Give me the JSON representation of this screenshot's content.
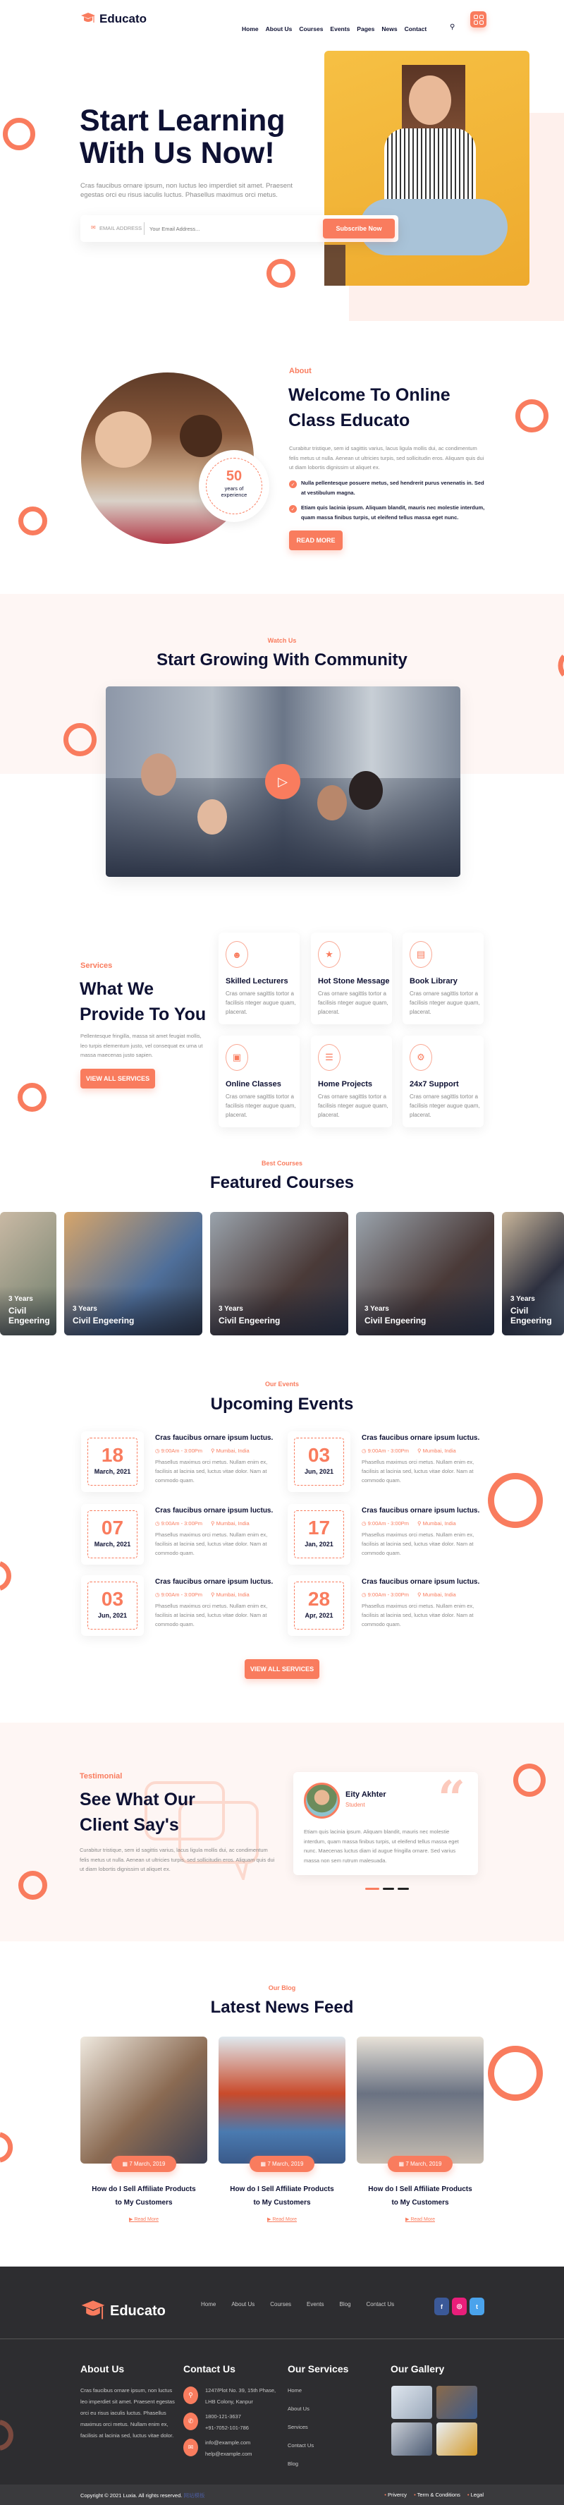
{
  "brand": {
    "name": "Educato",
    "accent": "#f97c5e",
    "dark": "#0e1133",
    "footer_bg": "#2d2d30"
  },
  "header": {
    "nav": [
      "Home",
      "About Us",
      "Courses",
      "Events",
      "Pages",
      "News",
      "Contact"
    ],
    "search_icon": "search-icon",
    "menu_icon": "grid-menu-icon"
  },
  "hero": {
    "title_line1": "Start Learning",
    "title_line2": "With Us Now!",
    "text": "Cras faucibus ornare ipsum, non luctus leo imperdiet sit amet. Praesent egestas orci eu risus iaculis luctus. Phasellus maximus orci metus.",
    "email_label": "EMAIL ADDRESS",
    "email_placeholder": "Your Email Address...",
    "subscribe": "Subscribe Now"
  },
  "about": {
    "sub": "About",
    "title_line1": "Welcome To Online",
    "title_line2": "Class Educato",
    "text": "Curabitur tristique, sem id sagittis varius, lacus ligula mollis dui, ac condimentum felis metus ut nulla. Aenean ut ultricies turpis, sed sollicitudin eros. Aliquam quis dui ut diam lobortis dignissim ut aliquet ex.",
    "points": [
      "Nulla pellentesque posuere metus, sed hendrerit purus venenatis in. Sed at vestibulum magna.",
      "Etiam quis lacinia ipsum. Aliquam blandit, mauris nec molestie interdum, quam massa finibus turpis, ut eleifend tellus massa eget nunc."
    ],
    "badge_number": "50",
    "badge_text1": "years of",
    "badge_text2": "experience",
    "button": "READ MORE"
  },
  "watch": {
    "sub": "Watch Us",
    "title": "Start Growing With Community"
  },
  "services": {
    "sub": "Services",
    "title_line1": "What We",
    "title_line2": "Provide To You",
    "text": "Pellentesque fringilla, massa sit amet feugiat mollis, leo turpis elementum justo, vel consequat ex urna ut massa maecenas justo sapien.",
    "button": "VIEW ALL SERVICES",
    "items": [
      {
        "title": "Skilled Lecturers",
        "text": "Cras ornare sagittis tortor a facilisis nteger augue quam, placerat.",
        "icon": "lecturer-icon"
      },
      {
        "title": "Hot Stone Message",
        "text": "Cras ornare sagittis tortor a facilisis nteger augue quam, placerat.",
        "icon": "trophy-icon"
      },
      {
        "title": "Book Library",
        "text": "Cras ornare sagittis tortor a facilisis nteger augue quam, placerat.",
        "icon": "book-icon"
      },
      {
        "title": "Online Classes",
        "text": "Cras ornare sagittis tortor a facilisis nteger augue quam, placerat.",
        "icon": "tablet-icon"
      },
      {
        "title": "Home Projects",
        "text": "Cras ornare sagittis tortor a facilisis nteger augue quam, placerat.",
        "icon": "document-icon"
      },
      {
        "title": "24x7 Support",
        "text": "Cras ornare sagittis tortor a facilisis nteger augue quam, placerat.",
        "icon": "support-icon"
      }
    ]
  },
  "courses": {
    "sub": "Best Courses",
    "title": "Featured Courses",
    "items": [
      {
        "years": "3 Years",
        "name": "Civil Engeering"
      },
      {
        "years": "3 Years",
        "name": "Civil Engeering"
      },
      {
        "years": "3 Years",
        "name": "Civil Engeering"
      },
      {
        "years": "3 Years",
        "name": "Civil Engeering"
      },
      {
        "years": "3 Years",
        "name": "Civil Engeering"
      }
    ]
  },
  "events": {
    "sub": "Our Events",
    "title": "Upcoming Events",
    "button": "VIEW ALL SERVICES",
    "items": [
      {
        "day": "18",
        "month": "March, 2021",
        "title": "Cras faucibus ornare ipsum luctus.",
        "time": "9:00Am - 3:00Pm",
        "place": "Mumbai, India",
        "text": "Phasellus maximus orci metus. Nullam enim ex, facilisis at lacinia sed, luctus vitae dolor. Nam at commodo quam."
      },
      {
        "day": "03",
        "month": "Jun, 2021",
        "title": "Cras faucibus ornare ipsum luctus.",
        "time": "9:00Am - 3:00Pm",
        "place": "Mumbai, India",
        "text": "Phasellus maximus orci metus. Nullam enim ex, facilisis at lacinia sed, luctus vitae dolor. Nam at commodo quam."
      },
      {
        "day": "07",
        "month": "March, 2021",
        "title": "Cras faucibus ornare ipsum luctus.",
        "time": "9:00Am - 3:00Pm",
        "place": "Mumbai, India",
        "text": "Phasellus maximus orci metus. Nullam enim ex, facilisis at lacinia sed, luctus vitae dolor. Nam at commodo quam."
      },
      {
        "day": "17",
        "month": "Jan, 2021",
        "title": "Cras faucibus ornare ipsum luctus.",
        "time": "9:00Am - 3:00Pm",
        "place": "Mumbai, India",
        "text": "Phasellus maximus orci metus. Nullam enim ex, facilisis at lacinia sed, luctus vitae dolor. Nam at commodo quam."
      },
      {
        "day": "03",
        "month": "Jun, 2021",
        "title": "Cras faucibus ornare ipsum luctus.",
        "time": "9:00Am - 3:00Pm",
        "place": "Mumbai, India",
        "text": "Phasellus maximus orci metus. Nullam enim ex, facilisis at lacinia sed, luctus vitae dolor. Nam at commodo quam."
      },
      {
        "day": "28",
        "month": "Apr, 2021",
        "title": "Cras faucibus ornare ipsum luctus.",
        "time": "9:00Am - 3:00Pm",
        "place": "Mumbai, India",
        "text": "Phasellus maximus orci metus. Nullam enim ex, facilisis at lacinia sed, luctus vitae dolor. Nam at commodo quam."
      }
    ]
  },
  "testimonial": {
    "sub": "Testimonial",
    "title_line1": "See What Our",
    "title_line2": "Client Say's",
    "text": "Curabitur tristique, sem id sagittis varius, lacus ligula mollis dui, ac condimentum felis metus ut nulla. Aenean ut ultricies turpis, sed sollicitudin eros. Aliquam quis dui ut diam lobortis dignissim ut aliquet ex.",
    "name": "Eity Akhter",
    "role": "Student",
    "quote": "Etiam quis lacinia ipsum. Aliquam blandit, mauris nec molestie interdum, quam massa finibus turpis, ut eleifend tellus massa eget nunc. Maecenas luctus diam id augue fringilla ornare. Sed varius massa non sem rutrum malesuada.",
    "active_slide": 1,
    "slides": 3
  },
  "blog": {
    "sub": "Our Blog",
    "title": "Latest News Feed",
    "items": [
      {
        "date": "7 March, 2019",
        "title": "How do I Sell Affiliate Products to My Customers",
        "more": "Read More"
      },
      {
        "date": "7 March, 2019",
        "title": "How do I Sell Affiliate Products to My Customers",
        "more": "Read More"
      },
      {
        "date": "7 March, 2019",
        "title": "How do I Sell Affiliate Products to My Customers",
        "more": "Read More"
      }
    ]
  },
  "footer": {
    "nav": [
      "Home",
      "About Us",
      "Courses",
      "Events",
      "Blog",
      "Contact Us"
    ],
    "social": [
      {
        "icon": "facebook-icon",
        "glyph": "f",
        "color": "#3b5998"
      },
      {
        "icon": "instagram-icon",
        "glyph": "◎",
        "color": "#e91e7a"
      },
      {
        "icon": "twitter-icon",
        "glyph": "t",
        "color": "#4aa3ec"
      }
    ],
    "about_title": "About Us",
    "about_text": "Cras faucibus ornare ipsum, non luctus leo imperdiet sit amet. Praesent egestas orci eu risus iaculis luctus. Phasellus maximus orci metus. Nullam enim ex, facilisis at lacinia sed, luctus vitae dolor.",
    "contact_title": "Contact Us",
    "address1": "1247/Plot No. 39, 15th Phase,",
    "address2": "LHB Colony, Kanpur",
    "phone1": "1800-121-3637",
    "phone2": "+91-7052-101-786",
    "email1": "info@example.com",
    "email2": "help@example.com",
    "services_title": "Our Services",
    "services": [
      "Home",
      "About Us",
      "Services",
      "Contact Us",
      "Blog"
    ],
    "gallery_title": "Our Gallery",
    "copyright": "Copyright © 2021 Luxia. All rights reserved.",
    "copyright_link": "网站模板",
    "legal": [
      "Privercy",
      "Term & Conditions",
      "Legal"
    ]
  }
}
